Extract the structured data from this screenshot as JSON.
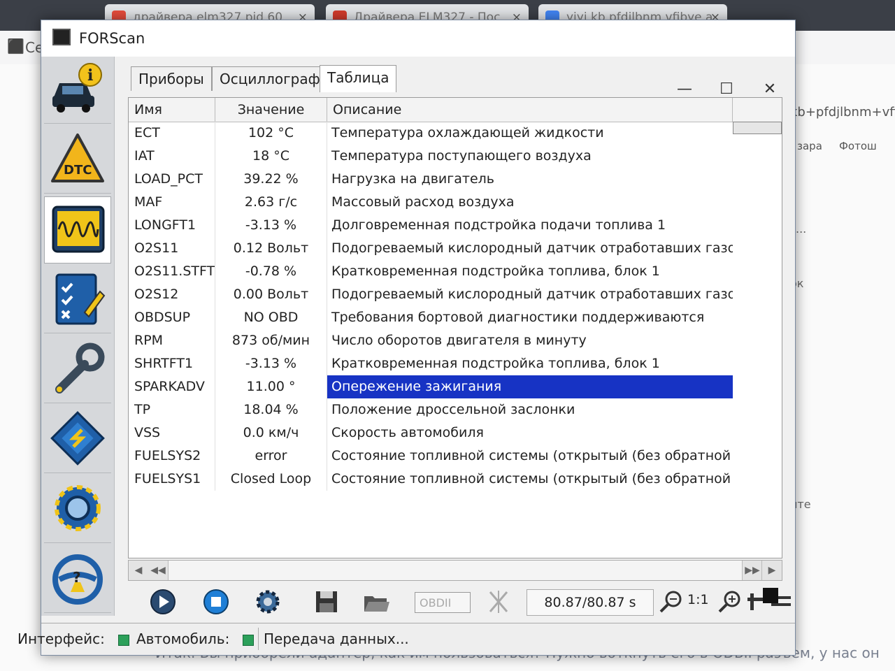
{
  "browser": {
    "tabs": [
      {
        "title": "драйвера elm327 pid 60",
        "close": "×"
      },
      {
        "title": "Драйвера ELM327 - Пос",
        "close": "×"
      },
      {
        "title": "yiyi kb pfdilbnm vfibye a",
        "close": "×"
      }
    ],
    "address_fragment": "kb+pfdjlbnm+vfib",
    "bookmarks": [
      "зара",
      "Фотош"
    ],
    "left_fragment": "Се",
    "side_fragments": [
      "...",
      "ок",
      "ите"
    ],
    "article_text": "Итак. Вы приобрели адаптер, как им пользоваться? Нужно воткнуть его в ODBII разъем, у нас он"
  },
  "app": {
    "title": "FORScan",
    "window_controls": {
      "minimize": "—",
      "maximize": "☐",
      "close": "✕"
    }
  },
  "sidebar": {
    "items": [
      {
        "icon": "vehicle-info-icon"
      },
      {
        "icon": "dtc-icon",
        "label": "DTC"
      },
      {
        "icon": "oscilloscope-icon"
      },
      {
        "icon": "checklist-icon"
      },
      {
        "icon": "wrench-icon"
      },
      {
        "icon": "chip-icon"
      },
      {
        "icon": "settings-gear-icon"
      },
      {
        "icon": "help-icon",
        "label": "?"
      }
    ]
  },
  "tabs": [
    {
      "label": "Приборы"
    },
    {
      "label": "Осциллограф"
    },
    {
      "label": "Таблица"
    }
  ],
  "table": {
    "headers": {
      "name": "Имя",
      "value": "Значение",
      "description": "Описание"
    },
    "rows": [
      {
        "name": "ECT",
        "value": "102 °C",
        "desc": "Температура охлаждающей жидкости"
      },
      {
        "name": "IAT",
        "value": "18 °C",
        "desc": "Температура поступающего воздуха"
      },
      {
        "name": "LOAD_PCT",
        "value": "39.22 %",
        "desc": "Нагрузка на двигатель"
      },
      {
        "name": "MAF",
        "value": "2.63 г/с",
        "desc": "Массовый расход воздуха"
      },
      {
        "name": "LONGFT1",
        "value": "-3.13 %",
        "desc": "Долговременная подстройка подачи топлива 1"
      },
      {
        "name": "O2S11",
        "value": "0.12 Вольт",
        "desc": "Подогреваемый кислородный датчик отработавших газов (ряд ц"
      },
      {
        "name": "O2S11.STFT",
        "value": "-0.78 %",
        "desc": "Кратковременная подстройка топлива, блок 1"
      },
      {
        "name": "O2S12",
        "value": "0.00 Вольт",
        "desc": "Подогреваемый кислородный датчик отработавших газов (ряд ц"
      },
      {
        "name": "OBDSUP",
        "value": "NO OBD",
        "desc": "Требования бортовой диагностики поддерживаются"
      },
      {
        "name": "RPM",
        "value": "873 об/мин",
        "desc": "Число оборотов двигателя в минуту"
      },
      {
        "name": "SHRTFT1",
        "value": "-3.13 %",
        "desc": "Кратковременная подстройка топлива, блок 1"
      },
      {
        "name": "SPARKADV",
        "value": "11.00 °",
        "desc": "Опережение зажигания",
        "selected": true
      },
      {
        "name": "TP",
        "value": "18.04 %",
        "desc": "Положение дроссельной заслонки"
      },
      {
        "name": "VSS",
        "value": "0.0 км/ч",
        "desc": "Скорость автомобиля"
      },
      {
        "name": "FUELSYS2",
        "value": "error",
        "desc": "Состояние топливной системы (открытый (без обратной связи)/"
      },
      {
        "name": "FUELSYS1",
        "value": "Closed Loop",
        "desc": "Состояние топливной системы (открытый (без обратной связи)/"
      }
    ]
  },
  "timeline": {
    "left_buttons": [
      "◀",
      "◀◀"
    ],
    "right_buttons": [
      "▶▶",
      "▶"
    ]
  },
  "toolbar": {
    "protocol": "OBDII",
    "time": "80.87/80.87 s",
    "ratio": "1:1"
  },
  "status": {
    "interface_label": "Интерфейс:",
    "vehicle_label": "Автомобиль:",
    "message": "Передача данных..."
  },
  "colors": {
    "selection": "#1733c4",
    "status_ok": "#2ca05a"
  }
}
